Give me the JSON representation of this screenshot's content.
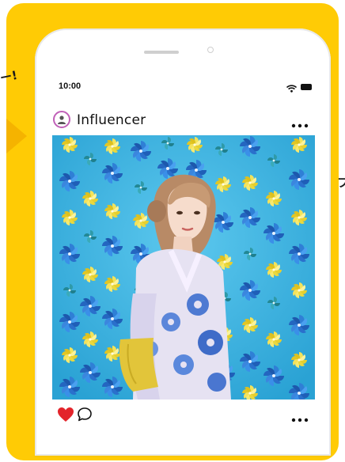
{
  "background": {
    "left_text": "ー!",
    "right_text": "フ"
  },
  "status_bar": {
    "time": "10:00"
  },
  "post": {
    "username": "Influencer"
  },
  "colors": {
    "frame": "#ffcb05",
    "pointer": "#f5b300",
    "avatar_ring": "#c060b8",
    "heart": "#e3242b",
    "photo_sky": "#3fb3de",
    "flower_blue": "#2f7fd6",
    "flower_yellow": "#f3e35a"
  },
  "icons": [
    "avatar-icon",
    "more-icon",
    "wifi-icon",
    "battery-icon",
    "heart-icon",
    "comment-icon"
  ]
}
